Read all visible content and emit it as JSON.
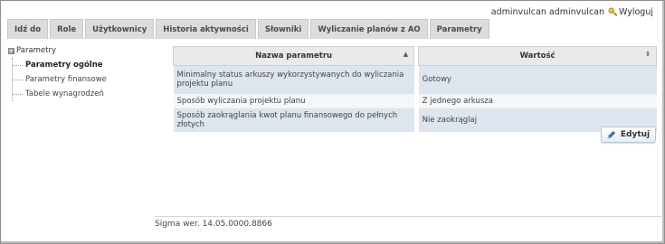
{
  "user": {
    "name": "adminvulcan adminvulcan",
    "logout_label": "Wyloguj"
  },
  "tabs": [
    {
      "label": "Idź do"
    },
    {
      "label": "Role"
    },
    {
      "label": "Użytkownicy"
    },
    {
      "label": "Historia aktywności"
    },
    {
      "label": "Słowniki"
    },
    {
      "label": "Wyliczanie planów z AO"
    },
    {
      "label": "Parametry"
    }
  ],
  "tree": {
    "root_label": "Parametry",
    "expander": "⊟",
    "items": [
      {
        "label": "Parametry ogólne",
        "active": true
      },
      {
        "label": "Parametry finansowe"
      },
      {
        "label": "Tabele wynagrodzeń"
      }
    ]
  },
  "table": {
    "headers": {
      "name": "Nazwa parametru",
      "value": "Wartość"
    },
    "sort_icons": {
      "name": "▲",
      "value": "⇕"
    },
    "rows": [
      {
        "name": "Minimalny status arkuszy wykorzystywanych do wyliczania projektu planu",
        "value": "Gotowy"
      },
      {
        "name": "Sposób wyliczania projektu planu",
        "value": "Z jednego arkusza"
      },
      {
        "name": "Sposób zaokrąglania kwot planu finansowego do pełnych złotych",
        "value": "Nie zaokrąglaj"
      }
    ]
  },
  "edit_button": {
    "label": "Edytuj"
  },
  "footer": {
    "version": "Sigma wer. 14.05.0000.8866"
  },
  "colors": {
    "tab_bg": "#dcdcdc",
    "row_odd": "#dde5ee",
    "row_even": "#f4f6f8",
    "header_bg": "#eaeaea"
  }
}
